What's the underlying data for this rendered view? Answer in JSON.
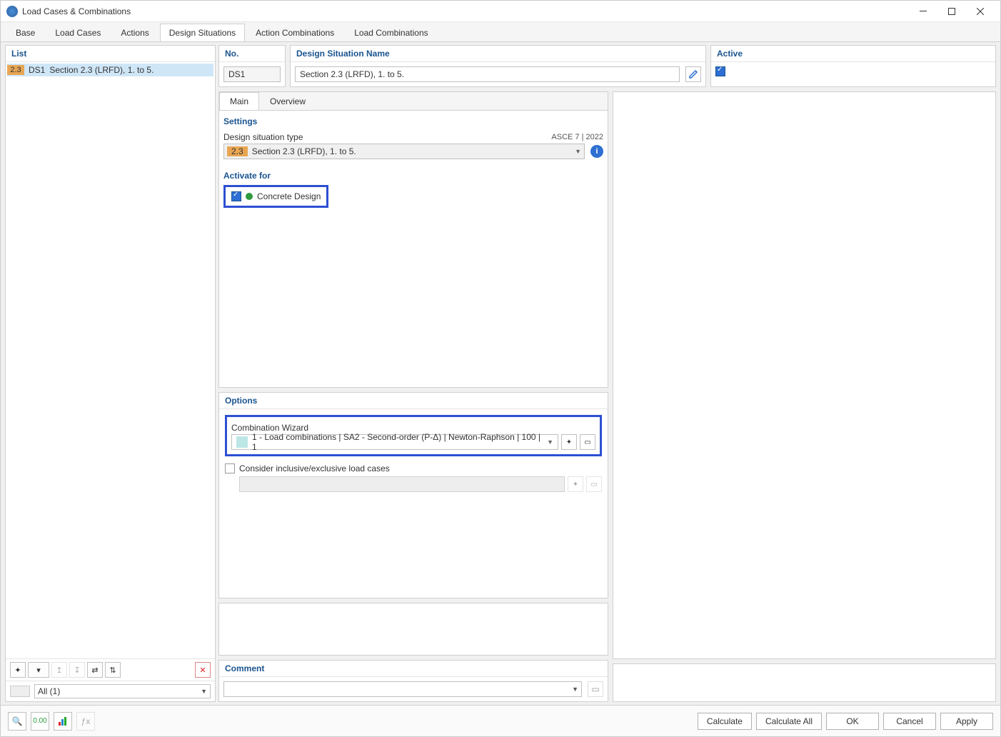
{
  "window": {
    "title": "Load Cases & Combinations"
  },
  "topTabs": {
    "base": "Base",
    "loadCases": "Load Cases",
    "actions": "Actions",
    "designSituations": "Design Situations",
    "actionCombinations": "Action Combinations",
    "loadCombinations": "Load Combinations"
  },
  "list": {
    "header": "List",
    "items": [
      {
        "badge": "2.3",
        "id": "DS1",
        "label": "Section 2.3 (LRFD), 1. to 5."
      }
    ],
    "filter": "All (1)"
  },
  "detail": {
    "no": {
      "header": "No.",
      "value": "DS1"
    },
    "name": {
      "header": "Design Situation Name",
      "value": "Section 2.3 (LRFD), 1. to 5."
    },
    "active": {
      "header": "Active",
      "checked": true
    },
    "subTabs": {
      "main": "Main",
      "overview": "Overview"
    },
    "settings": {
      "header": "Settings",
      "typeLabel": "Design situation type",
      "standard": "ASCE 7 | 2022",
      "typeBadge": "2.3",
      "typeValue": "Section 2.3 (LRFD), 1. to 5."
    },
    "activateFor": {
      "header": "Activate for",
      "concrete": "Concrete Design"
    },
    "options": {
      "header": "Options",
      "wizardLabel": "Combination Wizard",
      "wizardValue": "1 - Load combinations | SA2 - Second-order (P-Δ) | Newton-Raphson | 100 | 1",
      "considerLabel": "Consider inclusive/exclusive load cases"
    },
    "comment": {
      "header": "Comment",
      "value": ""
    }
  },
  "footer": {
    "calculate": "Calculate",
    "calculateAll": "Calculate All",
    "ok": "OK",
    "cancel": "Cancel",
    "apply": "Apply"
  }
}
